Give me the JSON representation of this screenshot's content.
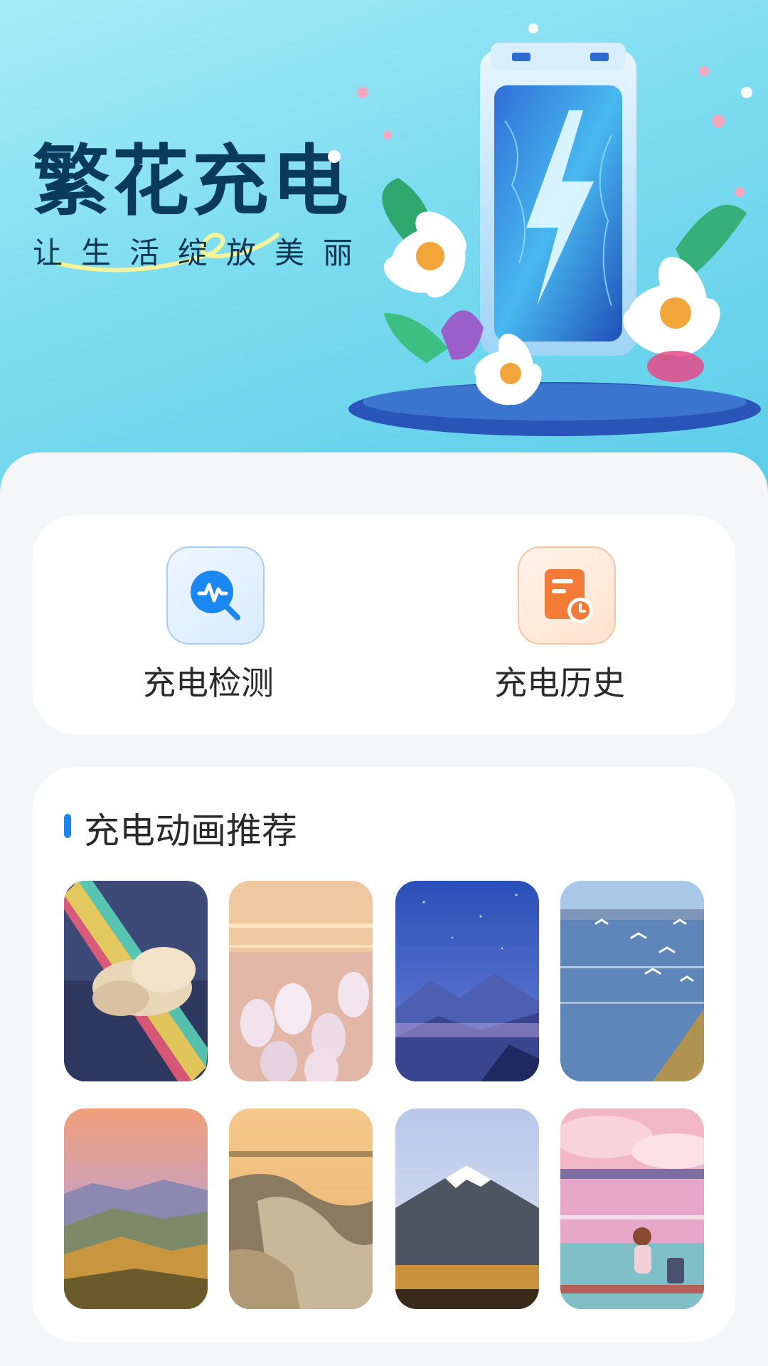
{
  "hero": {
    "title": "繁花充电",
    "subtitle": "让生活绽放美丽",
    "illustration": "battery-with-flowers-illustration"
  },
  "actions": [
    {
      "label": "充电检测",
      "icon": "magnifier-pulse-icon",
      "accent": "#1a88f0"
    },
    {
      "label": "充电历史",
      "icon": "document-clock-icon",
      "accent": "#f27b37"
    }
  ],
  "recommend": {
    "title": "充电动画推荐",
    "marker_color": "#1a88f0",
    "thumbnails": [
      {
        "subject": "rainbow-cloud-over-sea"
      },
      {
        "subject": "glass-tulips-on-water"
      },
      {
        "subject": "starry-sky-over-mountains"
      },
      {
        "subject": "seagulls-over-lake"
      },
      {
        "subject": "sunset-hills"
      },
      {
        "subject": "golden-ocean-wave"
      },
      {
        "subject": "snow-capped-mountain"
      },
      {
        "subject": "girl-on-bench-by-pink-sea"
      }
    ]
  }
}
